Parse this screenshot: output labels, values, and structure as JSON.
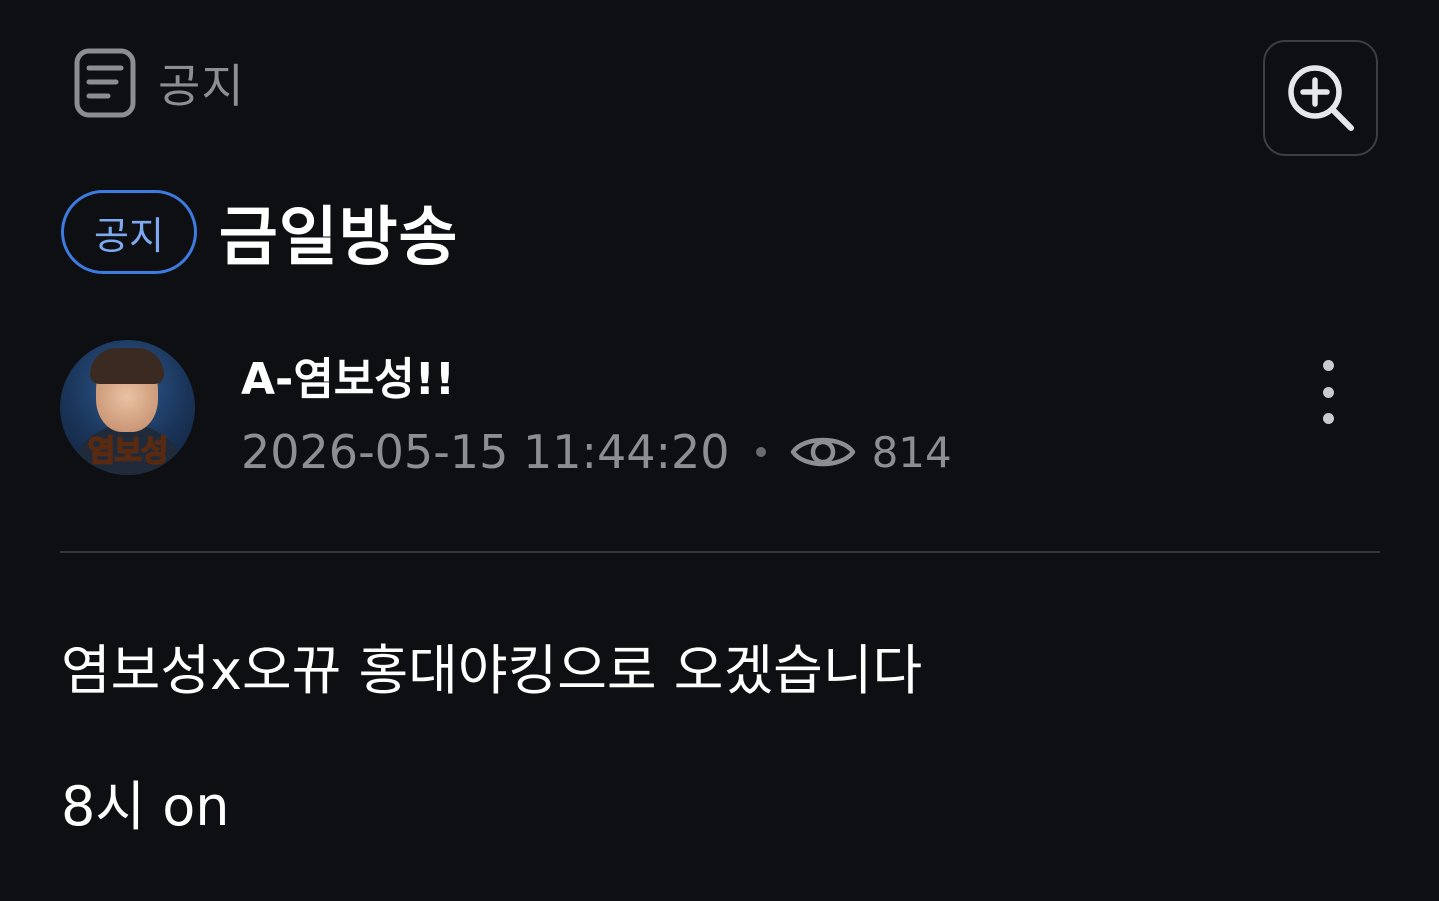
{
  "breadcrumb": {
    "icon": "document-list-icon",
    "label": "공지"
  },
  "toolbar": {
    "zoom_icon": "zoom-in-icon"
  },
  "post": {
    "badge": "공지",
    "title": "금일방송",
    "author": {
      "name": "A-염보성!!",
      "avatar_text": "염보성"
    },
    "timestamp": "2026-05-15 11:44:20",
    "views": "814",
    "body": [
      "염보성x오뀨 홍대야킹으로 오겠습니다",
      "8시 on"
    ]
  },
  "colors": {
    "background": "#0e0f12",
    "badge_border": "#3d7be0",
    "muted_text": "#8d8e93"
  }
}
